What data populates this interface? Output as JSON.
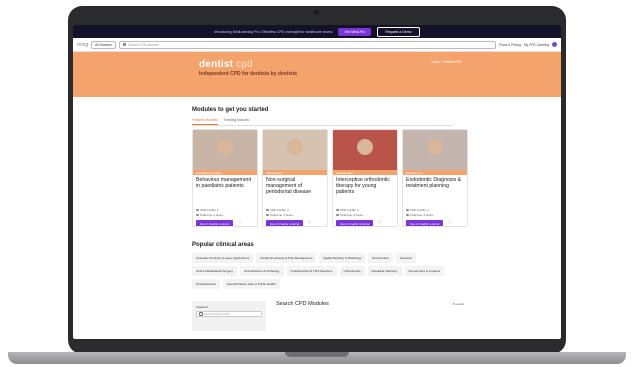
{
  "promo": {
    "text": "Introducing MedLearning Pro. Effortless CPD oversight for healthcare teams",
    "primary_button": "Get MedLPro",
    "secondary_button": "Request a Demo"
  },
  "navbar": {
    "brand": "rning",
    "sections_label": "All Sections",
    "search_placeholder": "Search CPD Modules",
    "links": [
      "Plans & Pricing",
      "My CPD Learning"
    ]
  },
  "hero": {
    "logo_main": "dentist",
    "logo_suffix": " cpd",
    "tagline": "Independent CPD for dentists by dentists",
    "breadcrumb": "Home > Dentist CPD"
  },
  "modules": {
    "title": "Modules to get you started",
    "tabs": [
      "Featured Modules",
      "Trending Modules"
    ],
    "cards": [
      {
        "ribbon": "Paediatric Dentistry",
        "title": "Behaviour management in paediatric patients",
        "credits": "CPD Credits: 2",
        "time": "Total time: 2 hours",
        "button": "Use 2 Credits to Enrol",
        "image_color": "#c9b5a8"
      },
      {
        "ribbon": "Periodontics",
        "title": "Non-surgical management of periodontal disease",
        "credits": "CPD Credits: 3",
        "time": "Total time: 3 hours",
        "button": "Use 3 Credits to Enrol",
        "image_color": "#d5c2b0"
      },
      {
        "ribbon": "Orthodontics",
        "title": "Interceptive orthodontic therapy for young patients",
        "credits": "CPD Credits: 3",
        "time": "Total time: 3 hours",
        "button": "Use 3 Credits to Enrol",
        "image_color": "#b8544a"
      },
      {
        "ribbon": "Endodontics",
        "title": "Endodontic Diagnosis & treatment planning",
        "credits": "CPD Credits: 2",
        "time": "Total time: 2 hours",
        "button": "Use 2 Credits to Enrol",
        "image_color": "#c4b6ae"
      }
    ]
  },
  "clinical": {
    "title": "Popular clinical areas",
    "chips": [
      "Cosmetic Dentistry & Laser Applications",
      "Dental Anesthesia & Pain Management",
      "Digital Dentistry & Radiology",
      "Endodontics",
      "Featured",
      "Oral & Maxillofacial Surgery",
      "Oral Medicine & Pathology",
      "Orofacial Pain & TMJ Disorders",
      "Orthodontics",
      "Paediatric Dentistry",
      "Periodontics & Implants",
      "Prosthodontics",
      "Special Patient Care & Public Health"
    ]
  },
  "search_section": {
    "filter_label": "Keyword",
    "filter_placeholder": "Search Dentist CPD...",
    "title": "Search CPD Modules",
    "results": "8 results"
  },
  "colors": {
    "accent": "#f4a36c",
    "primary_button": "#7a35d6"
  }
}
